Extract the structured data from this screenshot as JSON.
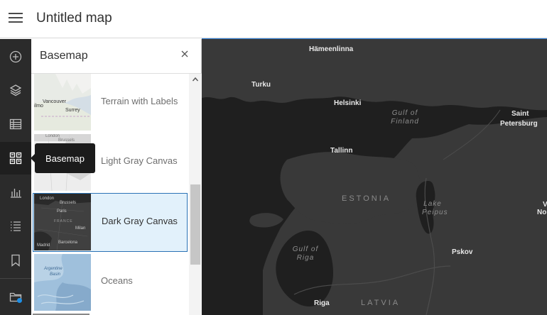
{
  "header": {
    "title": "Untitled map"
  },
  "rail": {
    "buttons": [
      {
        "name": "add-icon"
      },
      {
        "name": "layers-icon"
      },
      {
        "name": "table-icon"
      },
      {
        "name": "basemap-icon"
      },
      {
        "name": "charts-icon"
      },
      {
        "name": "legend-icon"
      },
      {
        "name": "bookmark-icon"
      },
      {
        "name": "map-properties-icon"
      }
    ],
    "tooltip": "Basemap"
  },
  "panel": {
    "title": "Basemap",
    "items": [
      {
        "label": "Terrain with Labels",
        "thumb_text": [
          "Vancouver",
          "Surrey",
          "ilmo"
        ]
      },
      {
        "label": "Light Gray Canvas",
        "thumb_text": [
          "London",
          "Brussels"
        ]
      },
      {
        "label": "Dark Gray Canvas",
        "thumb_text": [
          "London",
          "Brussels",
          "Paris",
          "FRANCE",
          "Milan",
          "Madrid",
          "Barcelona"
        ],
        "selected": true
      },
      {
        "label": "Oceans",
        "thumb_text": [
          "Argentine",
          "Basin"
        ]
      }
    ]
  },
  "map": {
    "cities": [
      "Hämeenlinna",
      "Turku",
      "Helsinki",
      "Saint",
      "Petersburg",
      "Tallinn",
      "Pskov",
      "Riga",
      "V",
      "No"
    ],
    "water": [
      "Gulf of",
      "Finland",
      "Lake",
      "Peipus",
      "Gulf of",
      "Riga"
    ],
    "countries": [
      "ESTONIA",
      "LATVIA"
    ]
  },
  "colors": {
    "accent": "#2a72b5",
    "rail_bg": "#2b2b2b",
    "map_bg": "#2b2b2b",
    "land": "#3a3a3a"
  }
}
